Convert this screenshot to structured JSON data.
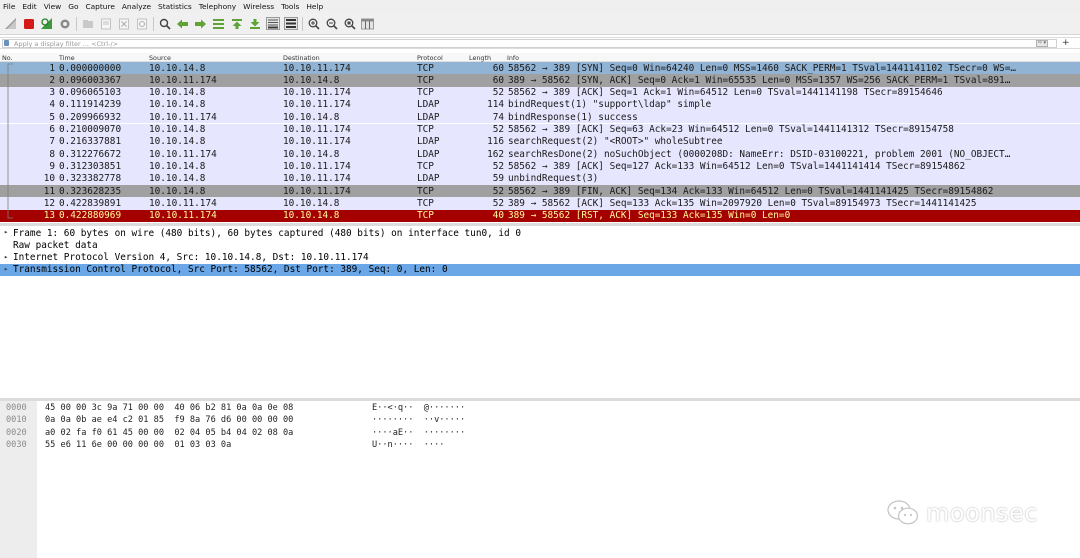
{
  "menu": [
    "File",
    "Edit",
    "View",
    "Go",
    "Capture",
    "Analyze",
    "Statistics",
    "Telephony",
    "Wireless",
    "Tools",
    "Help"
  ],
  "filter": {
    "placeholder": "Apply a display filter ... <Ctrl-/>",
    "plus": "+"
  },
  "columns": {
    "no": "No.",
    "time": "Time",
    "source": "Source",
    "destination": "Destination",
    "protocol": "Protocol",
    "length": "Length",
    "info": "Info"
  },
  "packets": [
    {
      "no": "1",
      "time": "0.000000000",
      "src": "10.10.14.8",
      "dst": "10.10.11.174",
      "proto": "TCP",
      "len": "60",
      "info": "58562 → 389 [SYN] Seq=0 Win=64240 Len=0 MSS=1460 SACK_PERM=1 TSval=1441141102 TSecr=0 WS=…",
      "style": "sel"
    },
    {
      "no": "2",
      "time": "0.096003367",
      "src": "10.10.11.174",
      "dst": "10.10.14.8",
      "proto": "TCP",
      "len": "60",
      "info": "389 → 58562 [SYN, ACK] Seq=0 Ack=1 Win=65535 Len=0 MSS=1357 WS=256 SACK_PERM=1 TSval=891…",
      "style": "synack"
    },
    {
      "no": "3",
      "time": "0.096065103",
      "src": "10.10.14.8",
      "dst": "10.10.11.174",
      "proto": "TCP",
      "len": "52",
      "info": "58562 → 389 [ACK] Seq=1 Ack=1 Win=64512 Len=0 TSval=1441141198 TSecr=89154646",
      "style": "tcp"
    },
    {
      "no": "4",
      "time": "0.111914239",
      "src": "10.10.14.8",
      "dst": "10.10.11.174",
      "proto": "LDAP",
      "len": "114",
      "info": "bindRequest(1) \"support\\ldap\" simple",
      "style": "ldap"
    },
    {
      "no": "5",
      "time": "0.209966932",
      "src": "10.10.11.174",
      "dst": "10.10.14.8",
      "proto": "LDAP",
      "len": "74",
      "info": "bindResponse(1) success",
      "style": "ldap"
    },
    {
      "no": "6",
      "time": "0.210009070",
      "src": "10.10.14.8",
      "dst": "10.10.11.174",
      "proto": "TCP",
      "len": "52",
      "info": "58562 → 389 [ACK] Seq=63 Ack=23 Win=64512 Len=0 TSval=1441141312 TSecr=89154758",
      "style": "tcp"
    },
    {
      "no": "7",
      "time": "0.216337881",
      "src": "10.10.14.8",
      "dst": "10.10.11.174",
      "proto": "LDAP",
      "len": "116",
      "info": "searchRequest(2) \"<ROOT>\" wholeSubtree",
      "style": "ldap"
    },
    {
      "no": "8",
      "time": "0.312276672",
      "src": "10.10.11.174",
      "dst": "10.10.14.8",
      "proto": "LDAP",
      "len": "162",
      "info": "searchResDone(2) noSuchObject (0000208D: NameErr: DSID-03100221, problem 2001 (NO_OBJECT…",
      "style": "ldap"
    },
    {
      "no": "9",
      "time": "0.312303851",
      "src": "10.10.14.8",
      "dst": "10.10.11.174",
      "proto": "TCP",
      "len": "52",
      "info": "58562 → 389 [ACK] Seq=127 Ack=133 Win=64512 Len=0 TSval=1441141414 TSecr=89154862",
      "style": "tcp"
    },
    {
      "no": "10",
      "time": "0.323382778",
      "src": "10.10.14.8",
      "dst": "10.10.11.174",
      "proto": "LDAP",
      "len": "59",
      "info": "unbindRequest(3)",
      "style": "ldap"
    },
    {
      "no": "11",
      "time": "0.323628235",
      "src": "10.10.14.8",
      "dst": "10.10.11.174",
      "proto": "TCP",
      "len": "52",
      "info": "58562 → 389 [FIN, ACK] Seq=134 Ack=133 Win=64512 Len=0 TSval=1441141425 TSecr=89154862",
      "style": "fin"
    },
    {
      "no": "12",
      "time": "0.422839891",
      "src": "10.10.11.174",
      "dst": "10.10.14.8",
      "proto": "TCP",
      "len": "52",
      "info": "389 → 58562 [ACK] Seq=133 Ack=135 Win=2097920 Len=0 TSval=89154973 TSecr=1441141425",
      "style": "tcp"
    },
    {
      "no": "13",
      "time": "0.422880969",
      "src": "10.10.11.174",
      "dst": "10.10.14.8",
      "proto": "TCP",
      "len": "40",
      "info": "389 → 58562 [RST, ACK] Seq=133 Ack=135 Win=0 Len=0",
      "style": "rst"
    }
  ],
  "details": [
    {
      "text": "Frame 1: 60 bytes on wire (480 bits), 60 bytes captured (480 bits) on interface tun0, id 0",
      "expand": "▸",
      "selected": false
    },
    {
      "text": "Raw packet data",
      "expand": "",
      "selected": false
    },
    {
      "text": "Internet Protocol Version 4, Src: 10.10.14.8, Dst: 10.10.11.174",
      "expand": "▸",
      "selected": false
    },
    {
      "text": "Transmission Control Protocol, Src Port: 58562, Dst Port: 389, Seq: 0, Len: 0",
      "expand": "▸",
      "selected": true
    }
  ],
  "bytes": [
    {
      "off": "0000",
      "hex": "45 00 00 3c 9a 71 00 00  40 06 b2 81 0a 0a 0e 08",
      "ascii": "E··<·q··  @·······"
    },
    {
      "off": "0010",
      "hex": "0a 0a 0b ae e4 c2 01 85  f9 8a 76 d6 00 00 00 00",
      "ascii": "········  ··v·····"
    },
    {
      "off": "0020",
      "hex": "a0 02 fa f0 61 45 00 00  02 04 05 b4 04 02 08 0a",
      "ascii": "····aE··  ········"
    },
    {
      "off": "0030",
      "hex": "55 e6 11 6e 00 00 00 00  01 03 03 0a",
      "ascii": "U··n····  ····"
    }
  ],
  "watermark": "moonsec"
}
